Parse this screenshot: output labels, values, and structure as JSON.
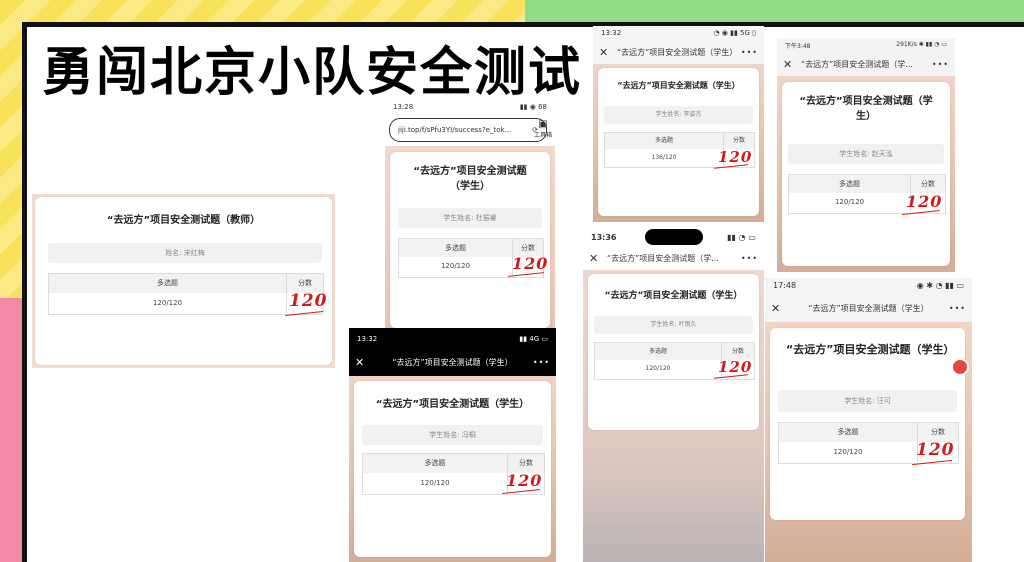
{
  "headline": "勇闯北京小队安全测试",
  "common": {
    "col_multi": "多选题",
    "col_score": "分数",
    "row_value": "120/120",
    "handwritten_score": "120",
    "close_glyph": "✕",
    "more_glyph": "•••"
  },
  "teacher": {
    "title": "“去远方”项目安全测试题（教师）",
    "name": "姓名: 宋红梅"
  },
  "s1": {
    "time": "13:28",
    "status_right": "▮▮ ◉ 68",
    "url": "jiji.top/f/sPfu3YI/success?e_tok...",
    "url_icon": "⟳",
    "toolbox_icon": "▣",
    "toolbox": "工具箱",
    "title": "“去远方”项目安全测试题（学生）",
    "name": "学生姓名: 杜振睿"
  },
  "s2": {
    "time": "13:32",
    "status_right": "▮▮ 4G ▭",
    "nav_title": "“去远方”项目安全测试题（学生）",
    "title": "“去远方”项目安全测试题（学生）",
    "name": "学生姓名: 冯桐"
  },
  "s3": {
    "time": "13:32",
    "status_right": "◔ ◉ ▮▮ 5G ▯",
    "nav_title": "“去远方”项目安全测试题（学生）",
    "title": "“去远方”项目安全测试题（学生）",
    "name": "学生姓名: 李姿杰",
    "row_value": "136/120"
  },
  "s4": {
    "time": "13:36",
    "status_right": "▮▮ ◔ ▭",
    "nav_title": "“去远方”项目安全测试题（学...",
    "title": "“去远方”项目安全测试题（学生）",
    "name": "学生姓名: 叶雨久"
  },
  "s5": {
    "time": "下午3:48",
    "status_right": "291K/s ✱ ▮▮ ◔ ▭",
    "nav_title": "“去远方”项目安全测试题（学...",
    "title": "“去远方”项目安全测试题（学生）",
    "name": "学生姓名: 赵天泓"
  },
  "s6": {
    "time": "17:48",
    "status_right": "◉ ✱ ◔ ▮▮ ▭",
    "nav_title": "“去远方”项目安全测试题（学生）",
    "title": "“去远方”项目安全测试题（学生）",
    "name": "学生姓名: 汪可"
  }
}
